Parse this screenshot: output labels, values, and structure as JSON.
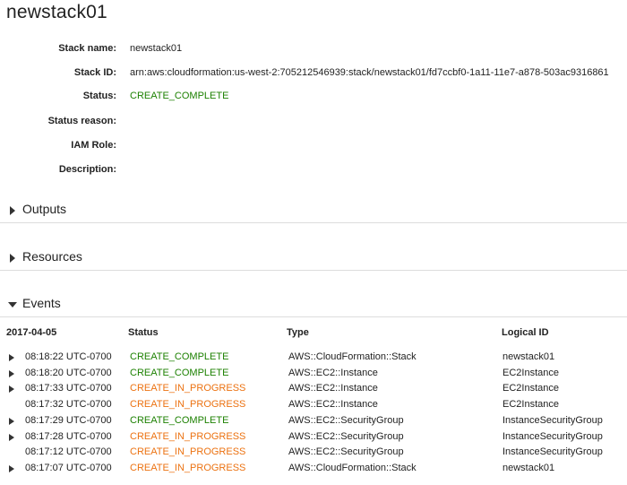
{
  "stack": {
    "title": "newstack01",
    "details": [
      {
        "label": "Stack name:",
        "value": "newstack01",
        "style": "plain"
      },
      {
        "label": "Stack ID:",
        "value": "arn:aws:cloudformation:us-west-2:705212546939:stack/newstack01/fd7ccbf0-1a11-11e7-a878-503ac9316861",
        "style": "plain"
      },
      {
        "label": "Status:",
        "value": "CREATE_COMPLETE",
        "style": "green"
      },
      {
        "label": "Status reason:",
        "value": "",
        "style": "plain"
      },
      {
        "label": "IAM Role:",
        "value": "",
        "style": "plain"
      },
      {
        "label": "Description:",
        "value": "",
        "style": "plain"
      }
    ]
  },
  "sections": {
    "outputs": {
      "label": "Outputs",
      "expanded": false
    },
    "resources": {
      "label": "Resources",
      "expanded": false
    },
    "events": {
      "label": "Events",
      "expanded": true
    }
  },
  "events": {
    "columns": {
      "date": "2017-04-05",
      "status": "Status",
      "type": "Type",
      "logical_id": "Logical ID"
    },
    "rows": [
      {
        "time": "08:18:22 UTC-0700",
        "status": "CREATE_COMPLETE",
        "type": "AWS::CloudFormation::Stack",
        "logical_id": "newstack01",
        "expandable": true
      },
      {
        "time": "08:18:20 UTC-0700",
        "status": "CREATE_COMPLETE",
        "type": "AWS::EC2::Instance",
        "logical_id": "EC2Instance",
        "expandable": true
      },
      {
        "time": "08:17:33 UTC-0700",
        "status": "CREATE_IN_PROGRESS",
        "type": "AWS::EC2::Instance",
        "logical_id": "EC2Instance",
        "expandable": true
      },
      {
        "time": "08:17:32 UTC-0700",
        "status": "CREATE_IN_PROGRESS",
        "type": "AWS::EC2::Instance",
        "logical_id": "EC2Instance",
        "expandable": false
      },
      {
        "time": "08:17:29 UTC-0700",
        "status": "CREATE_COMPLETE",
        "type": "AWS::EC2::SecurityGroup",
        "logical_id": "InstanceSecurityGroup",
        "expandable": true
      },
      {
        "time": "08:17:28 UTC-0700",
        "status": "CREATE_IN_PROGRESS",
        "type": "AWS::EC2::SecurityGroup",
        "logical_id": "InstanceSecurityGroup",
        "expandable": true
      },
      {
        "time": "08:17:12 UTC-0700",
        "status": "CREATE_IN_PROGRESS",
        "type": "AWS::EC2::SecurityGroup",
        "logical_id": "InstanceSecurityGroup",
        "expandable": false
      },
      {
        "time": "08:17:07 UTC-0700",
        "status": "CREATE_IN_PROGRESS",
        "type": "AWS::CloudFormation::Stack",
        "logical_id": "newstack01",
        "expandable": true
      }
    ]
  },
  "colors": {
    "complete": "#1d8102",
    "in_progress": "#ec7211",
    "divider": "#dddddd"
  },
  "icons": {
    "collapsed": "caret-right-icon",
    "expanded": "caret-down-icon"
  }
}
